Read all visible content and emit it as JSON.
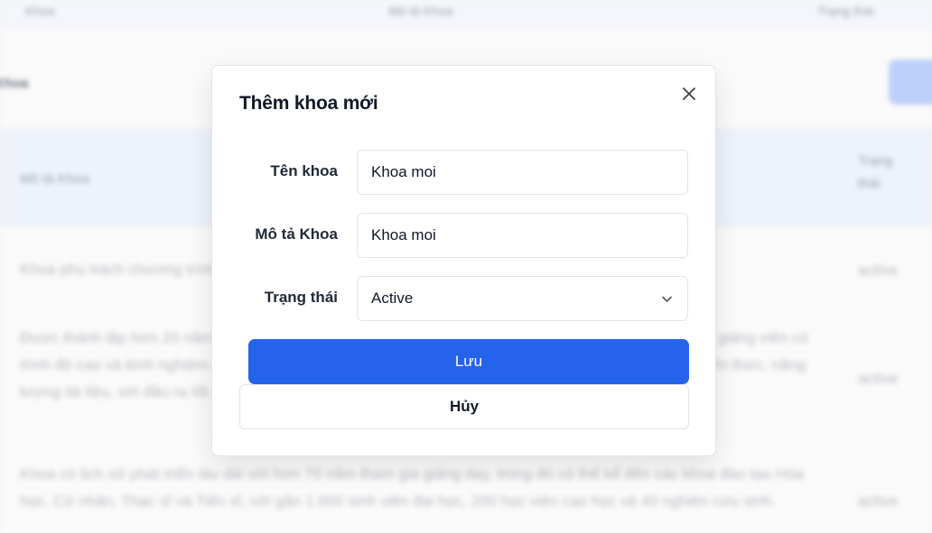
{
  "background": {
    "topbar": [
      "Khoa",
      "Mô tả Khoa",
      "Trạng thái"
    ],
    "left_label": "Khoa",
    "table_header": {
      "col1": "Mô tả Khoa",
      "col2": "Trạng thái"
    },
    "rows": [
      {
        "text": "Khoa phụ trách chương trình đào tạo...",
        "status": "active"
      },
      {
        "text": "Được thành lập hơn 20 năm, khoa đào tạo các ngành vật lý, sinh học, toán học và tin học, với đội ngũ giảng viên có trình độ cao và kinh nghiệm nghiên cứu chất lượng cao cho các ngành nghề trong xã hội, nâng cao kiến thức, năng lượng tài liệu, với đầu ra tốt.",
        "status": "active"
      },
      {
        "text": "Khoa có lịch sử phát triển lâu dài với hơn 70 năm tham gia giảng dạy, trong đó có thể kể đến các khoa đào tạo Hóa học, Cử nhân, Thạc sĩ và Tiến sĩ, với gần 1.000 sinh viên đại học, 200 học viên cao học và 40 nghiên cứu sinh.",
        "status": "active"
      }
    ]
  },
  "modal": {
    "title": "Thêm khoa mới",
    "fields": {
      "name": {
        "label": "Tên khoa",
        "value": "Khoa moi"
      },
      "description": {
        "label": "Mô tả Khoa",
        "value": "Khoa moi"
      },
      "status": {
        "label": "Trạng thái",
        "value": "Active"
      }
    },
    "save_label": "Lưu",
    "cancel_label": "Hủy"
  },
  "colors": {
    "primary": "#2563eb",
    "border": "#e4e4e7",
    "text": "#111827"
  }
}
